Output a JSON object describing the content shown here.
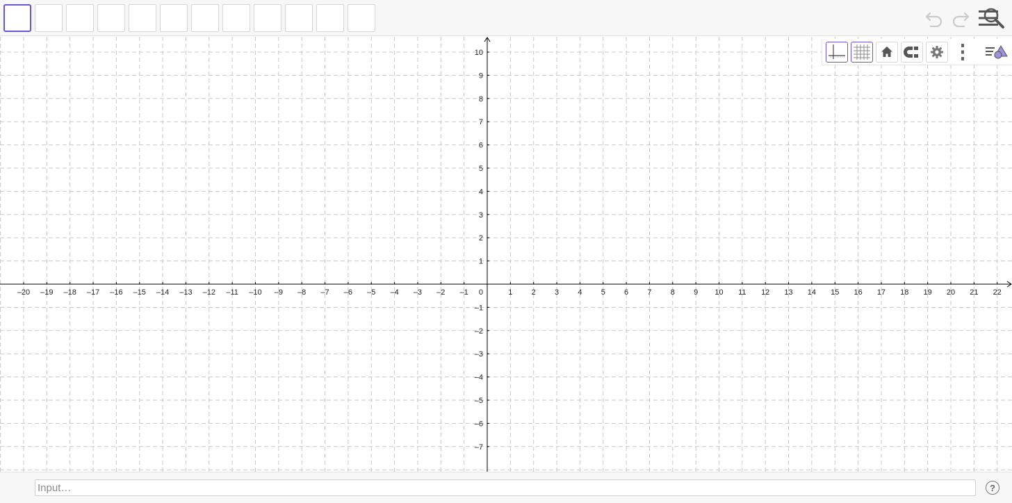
{
  "toolbar": {
    "tool_count": 12,
    "selected_tool_index": 0,
    "icons": [
      "undo-icon",
      "redo-icon",
      "search-icon",
      "menu-icon"
    ]
  },
  "stylebar": {
    "buttons": [
      "axes-toggle-icon",
      "grid-toggle-icon",
      "home-icon",
      "point-capture-icon",
      "settings-gear-icon",
      "more-vertical-icon",
      "algebra-view-toggle-icon"
    ],
    "axes_active": true,
    "grid_active": true
  },
  "input": {
    "placeholder": "Input…",
    "value": ""
  },
  "help": {
    "label": "?"
  },
  "graph": {
    "x_ticks": [
      "–20",
      "–19",
      "–18",
      "–17",
      "–16",
      "–15",
      "–14",
      "–13",
      "–12",
      "–11",
      "–10",
      "–9",
      "–8",
      "–7",
      "–6",
      "–5",
      "–4",
      "–3",
      "–2",
      "–1",
      "1",
      "2",
      "3",
      "4",
      "5",
      "6",
      "7",
      "8",
      "9",
      "10",
      "11",
      "12",
      "13",
      "14",
      "15",
      "16",
      "17",
      "18",
      "19",
      "20",
      "21",
      "22"
    ],
    "y_ticks": [
      "10",
      "9",
      "8",
      "7",
      "6",
      "5",
      "4",
      "3",
      "2",
      "1",
      "–1",
      "–2",
      "–3",
      "–4",
      "–5",
      "–6",
      "–7"
    ],
    "origin_label": "0",
    "x_range": [
      -21,
      22.6
    ],
    "y_range": [
      -8,
      10.7
    ],
    "grid": true,
    "colors": {
      "accent": "#6557d2",
      "grid": "#c8c8c8",
      "axis": "#000000"
    }
  }
}
